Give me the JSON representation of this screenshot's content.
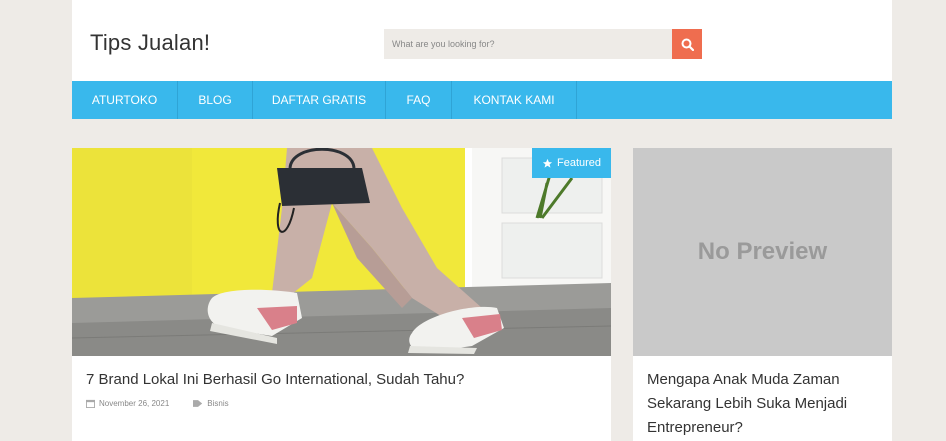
{
  "header": {
    "site_title": "Tips Jualan!",
    "search_placeholder": "What are you looking for?"
  },
  "nav": {
    "items": [
      {
        "label": "ATURTOKO"
      },
      {
        "label": "BLOG"
      },
      {
        "label": "DAFTAR GRATIS"
      },
      {
        "label": "FAQ"
      },
      {
        "label": "KONTAK KAMI"
      }
    ]
  },
  "featured_post": {
    "badge": "Featured",
    "title": "7 Brand Lokal Ini Berhasil Go International, Sudah Tahu?",
    "date": "November 26, 2021",
    "category": "Bisnis"
  },
  "side_post": {
    "placeholder_text": "No Preview",
    "title": "Mengapa Anak Muda Zaman Sekarang Lebih Suka Menjadi Entrepreneur?"
  },
  "colors": {
    "accent_blue": "#39b8ec",
    "search_orange": "#ef6d4f",
    "background": "#eeebe7"
  },
  "icons": {
    "search": "search-icon",
    "featured": "star-icon",
    "date": "calendar-icon",
    "category": "tag-icon"
  }
}
